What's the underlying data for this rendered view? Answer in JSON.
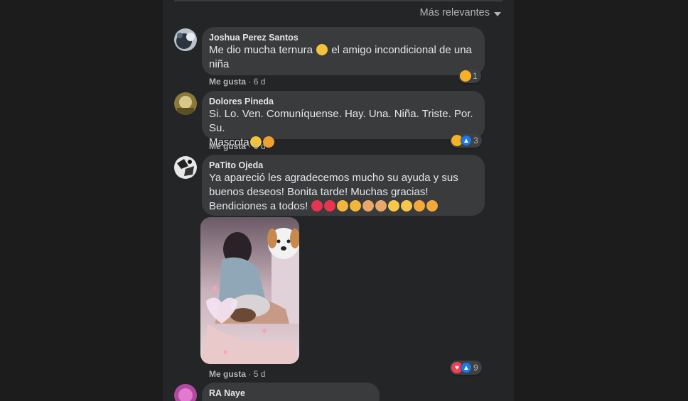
{
  "sort": {
    "label": "Más relevantes"
  },
  "comments": [
    {
      "author": "Joshua Perez Santos",
      "text_1": "Me dio mucha ternura",
      "text_2": "el amigo incondicional de una",
      "text_3": "niña",
      "like_label": "Me gusta",
      "time": "6 d",
      "reaction_count": "1",
      "reactions": [
        "sad-icon"
      ]
    },
    {
      "author": "Dolores Pineda",
      "text_1": "Si. Lo. Ven. Comuníquense. Hay. Una. Niña. Triste. Por. Su.",
      "text_2": "Mascota",
      "like_label": "Me gusta",
      "time": "6 d",
      "reaction_count": "3",
      "reactions": [
        "sad-icon",
        "like-icon"
      ]
    },
    {
      "author": "PaTito Ojeda",
      "text_1": "Ya apareció les agradecemos mucho su ayuda y sus",
      "text_2": "buenos deseos! Bonita tarde! Muchas gracias!",
      "text_3": "Bendiciones a todos!",
      "like_label": "Me gusta",
      "time": "5 d",
      "reaction_count": "9",
      "reactions": [
        "love-icon",
        "like-icon"
      ]
    },
    {
      "author": "RA Naye"
    }
  ],
  "colors": {
    "page_bg": "#1c1c1d",
    "panel_bg": "#242526",
    "bubble_bg": "#3a3b3c",
    "text_primary": "#e4e6eb",
    "text_secondary": "#b0b3b8",
    "like_blue": "#1877f2",
    "love_red": "#f33e58",
    "sad_yellow": "#f7b125"
  }
}
